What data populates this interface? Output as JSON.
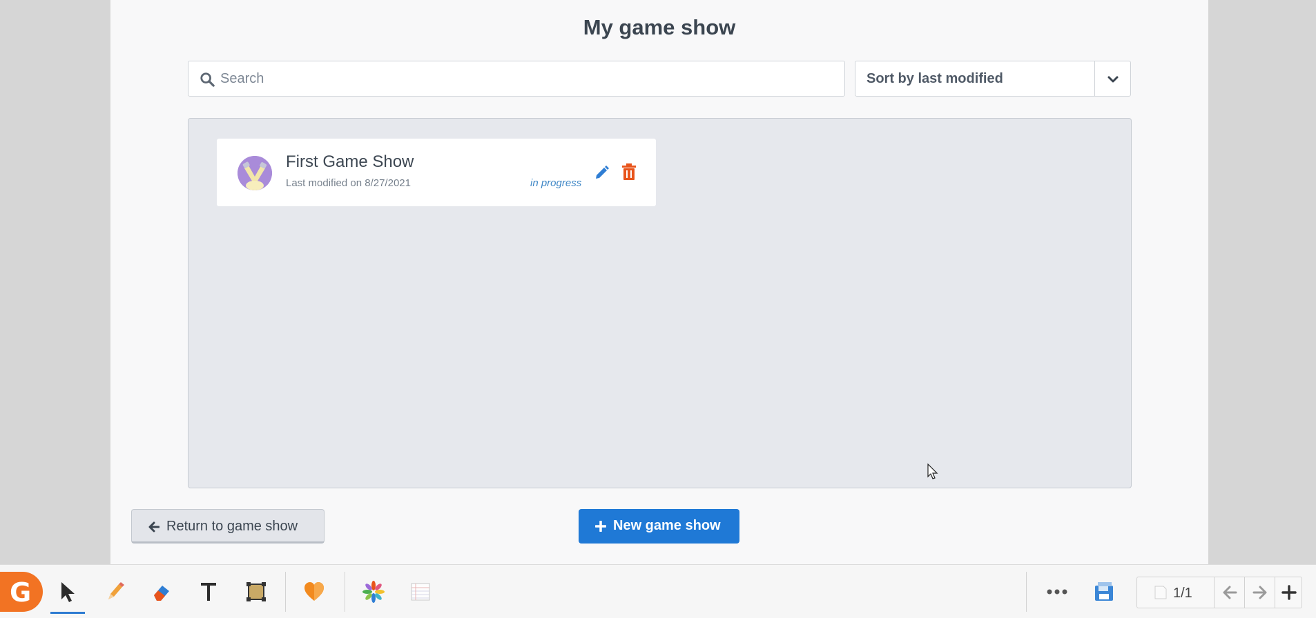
{
  "page": {
    "title": "My game show"
  },
  "search": {
    "placeholder": "Search",
    "value": ""
  },
  "sort": {
    "label": "Sort by last modified"
  },
  "games": [
    {
      "title": "First Game Show",
      "modified": "Last modified on 8/27/2021",
      "status": "in progress"
    }
  ],
  "buttons": {
    "return_label": "Return to game show",
    "new_label": "New game show"
  },
  "toolbar": {
    "logo_letter": "G",
    "page_indicator": "1/1"
  },
  "colors": {
    "primary": "#1f79d6",
    "delete": "#e8541b",
    "brand": "#f27323",
    "status": "#3f87c6"
  }
}
